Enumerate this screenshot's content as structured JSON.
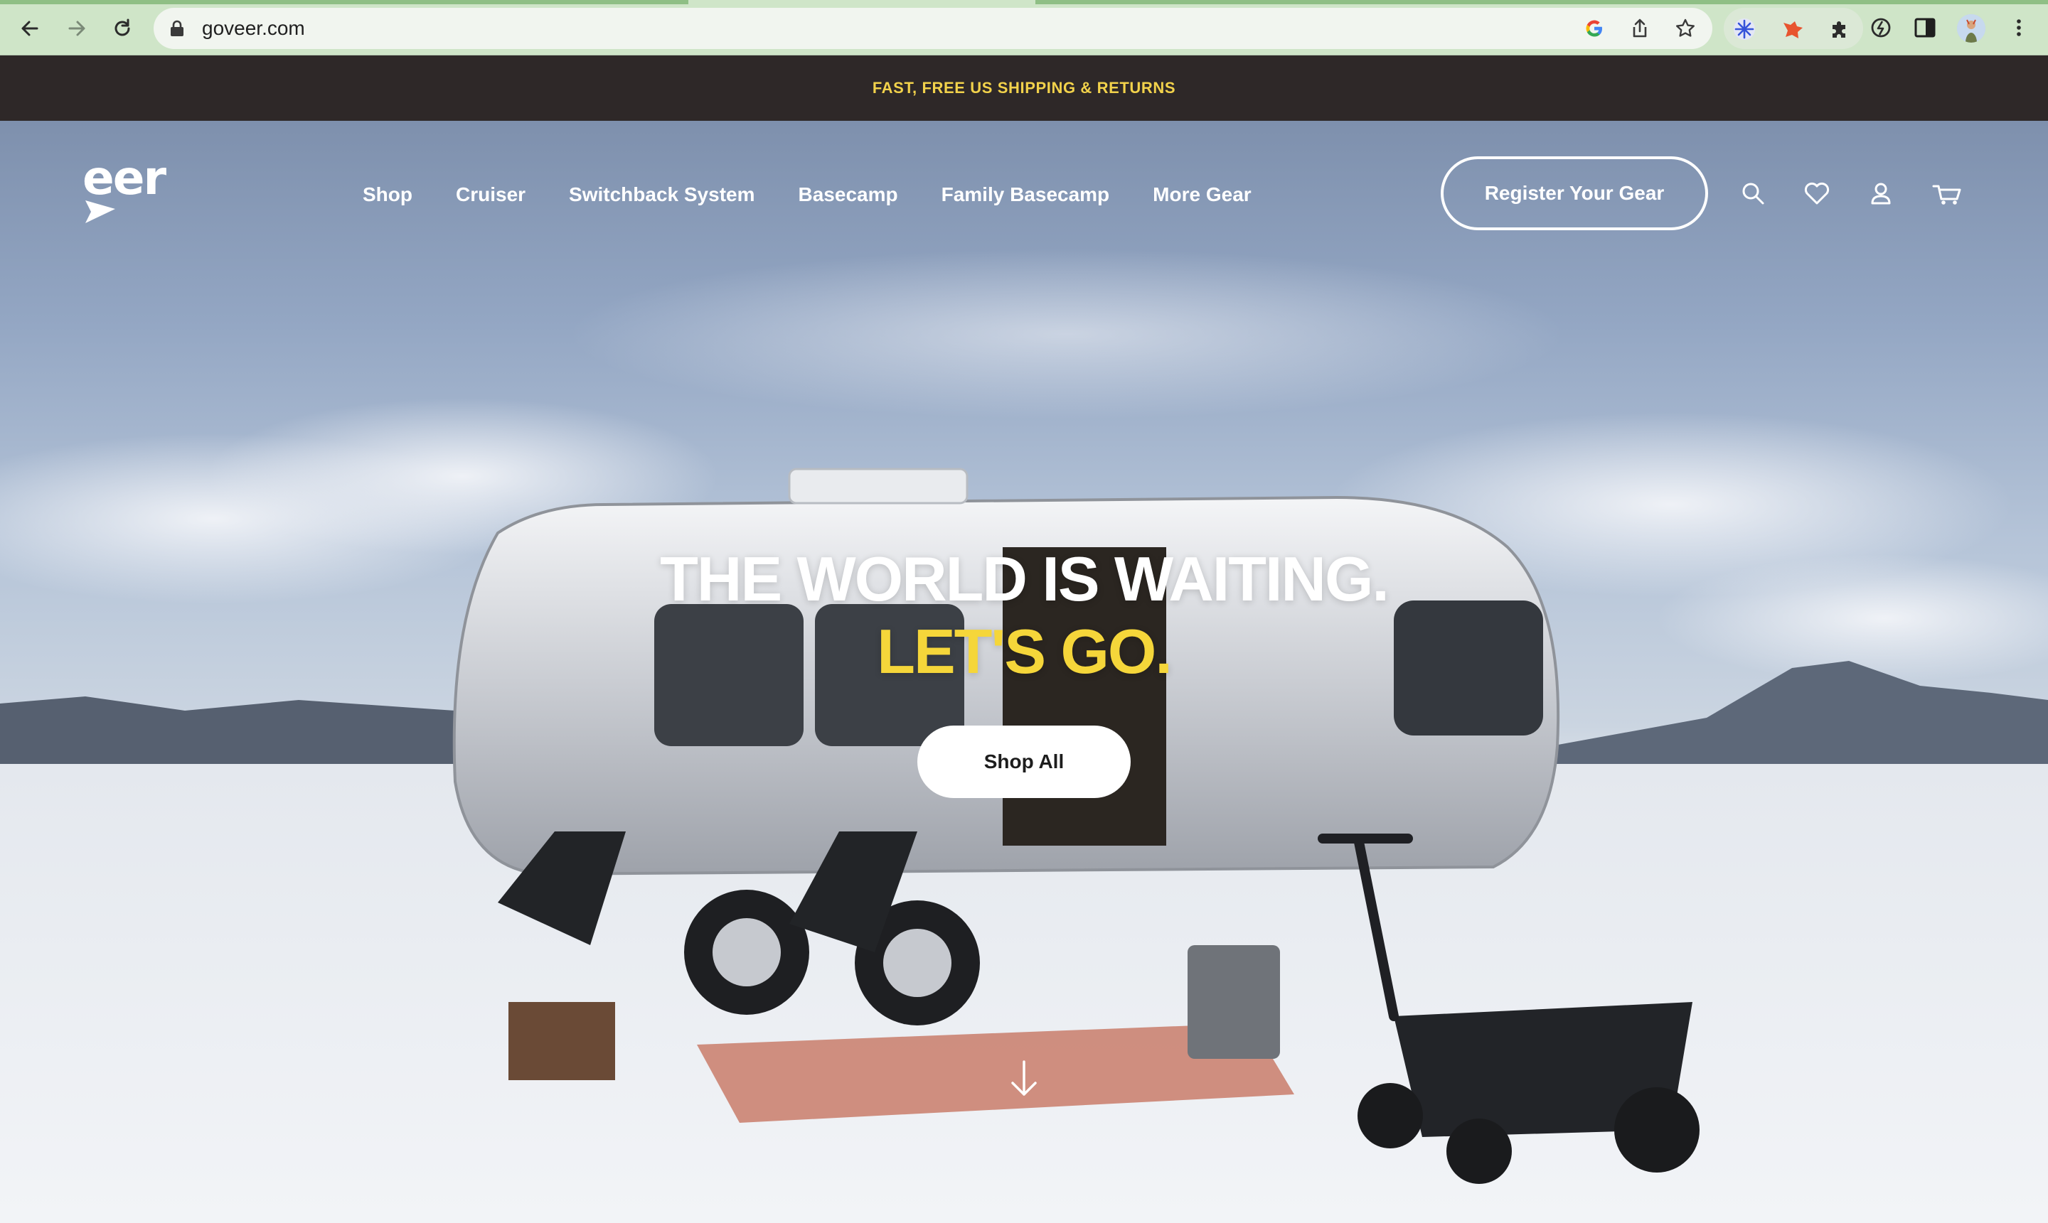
{
  "browser": {
    "url": "goveer.com",
    "icons": [
      "back-icon",
      "forward-icon",
      "reload-icon",
      "lock-icon",
      "google-icon",
      "share-icon",
      "bookmark-star-icon",
      "extension-icons",
      "puzzle-icon",
      "sync-icon",
      "sidebar-icon",
      "profile-avatar",
      "kebab-menu-icon"
    ]
  },
  "announcement": {
    "text": "FAST, FREE US SHIPPING & RETURNS",
    "text_color": "#f2d24b",
    "bg_color": "#2e2828"
  },
  "site_header": {
    "logo_text": "eer",
    "menu": [
      "Shop",
      "Cruiser",
      "Switchback System",
      "Basecamp",
      "Family Basecamp",
      "More Gear"
    ],
    "register_label": "Register Your Gear",
    "icons": [
      "search-icon",
      "heart-icon",
      "account-icon",
      "cart-icon"
    ]
  },
  "hero": {
    "headline_line1": "THE WORLD IS WAITING.",
    "headline_line2": "LET'S GO.",
    "headline_accent_color": "#f5d63a",
    "cta_label": "Shop All",
    "scroll_icon": "down-arrow-icon"
  }
}
